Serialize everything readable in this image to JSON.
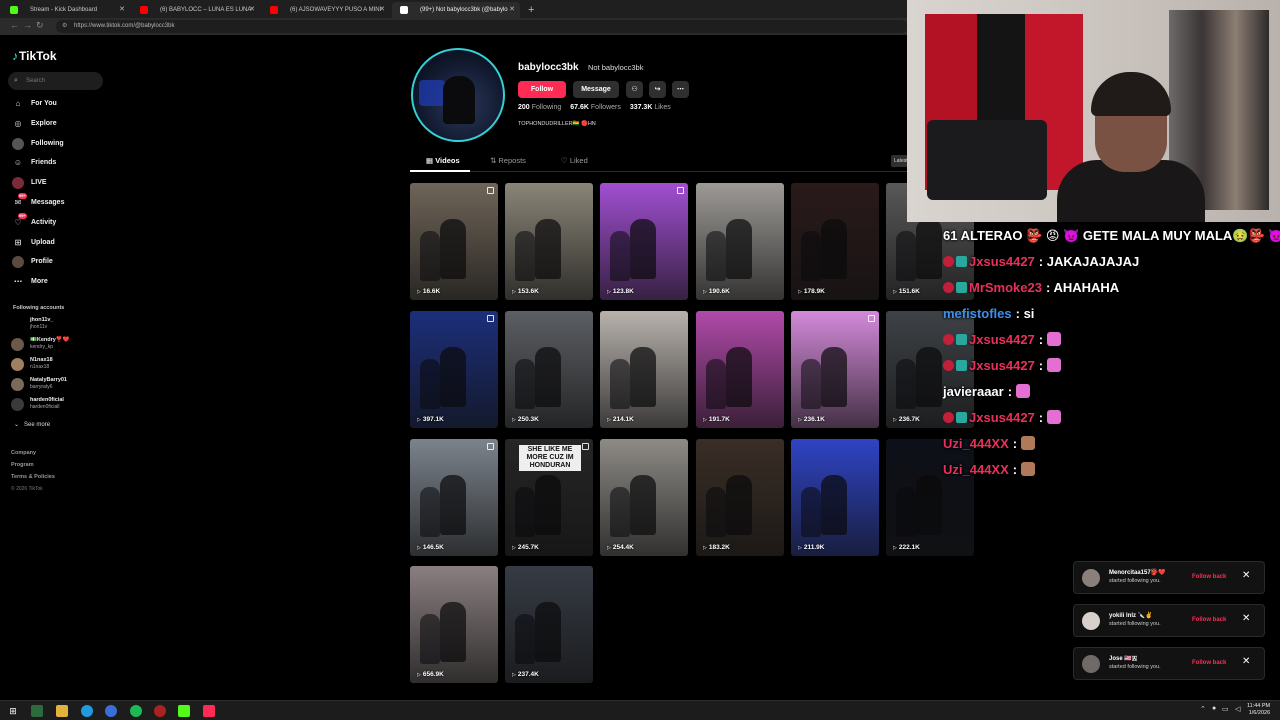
{
  "browser": {
    "tabs": [
      {
        "title": "Stream - Kick Dashboard",
        "fav_color": "#53fc18"
      },
      {
        "title": "(6) BABYLOCC – LUNA ES LUNA",
        "fav_color": "#ff0000"
      },
      {
        "title": "(6) AJSOWAVEYYY PUSO A MINI",
        "fav_color": "#ff0000"
      },
      {
        "title": "(99+) Not babylocc3bk (@babylo",
        "fav_color": "#ffffff"
      }
    ],
    "url": "https://www.tiktok.com/@babylocc3bk"
  },
  "sidebar": {
    "logo": "TikTok",
    "search_placeholder": "Search",
    "menu": [
      {
        "label": "For You",
        "icon": "home-icon"
      },
      {
        "label": "Explore",
        "icon": "compass-icon"
      },
      {
        "label": "Following",
        "icon": "following-icon"
      },
      {
        "label": "Friends",
        "icon": "friends-icon"
      },
      {
        "label": "LIVE",
        "icon": "live-icon"
      },
      {
        "label": "Messages",
        "icon": "messages-icon",
        "badge": "99+"
      },
      {
        "label": "Activity",
        "icon": "activity-icon",
        "badge": "99+"
      },
      {
        "label": "Upload",
        "icon": "upload-icon"
      },
      {
        "label": "Profile",
        "icon": "profile-icon"
      },
      {
        "label": "More",
        "icon": "more-icon"
      }
    ],
    "following_title": "Following accounts",
    "following": [
      {
        "name": "jhon11v_",
        "handle": "jhon11v"
      },
      {
        "name": "💵Kendry❣️❤️",
        "handle": "kendry_kp"
      },
      {
        "name": "N1nax18",
        "handle": "n1nax18"
      },
      {
        "name": "NatalyBarry01",
        "handle": "barryraty6"
      },
      {
        "name": "harden0ficial",
        "handle": "harden0ficiall"
      }
    ],
    "see_more": "See more",
    "footer": [
      "Company",
      "Program",
      "Terms & Policies",
      "© 2026 TikTok"
    ]
  },
  "profile": {
    "username": "babylocc3bk",
    "nickname": "Not babylocc3bk",
    "follow_label": "Follow",
    "message_label": "Message",
    "following_count": "200",
    "following_label": "Following",
    "followers_count": "67.6K",
    "followers_label": "Followers",
    "likes_count": "337.3K",
    "likes_label": "Likes",
    "bio": "TOPHONDUDRILLER🇧🇴 🔴HN",
    "tabs": [
      "Videos",
      "Reposts",
      "Liked"
    ],
    "latest_label": "Latest"
  },
  "videos": [
    {
      "views": "16.6K",
      "bg": "#6f6558",
      "pinned": true
    },
    {
      "views": "153.6K",
      "bg": "#8a8578",
      "pinned": false
    },
    {
      "views": "123.8K",
      "bg": "#a14fd1",
      "pinned": true
    },
    {
      "views": "190.6K",
      "bg": "#9d9a96",
      "pinned": false
    },
    {
      "views": "178.9K",
      "bg": "#2a1a1a",
      "pinned": false
    },
    {
      "views": "151.6K",
      "bg": "#585858",
      "pinned": false
    },
    {
      "views": "397.1K",
      "bg": "#1c2f7a",
      "pinned": true
    },
    {
      "views": "250.3K",
      "bg": "#5c5f63",
      "pinned": false
    },
    {
      "views": "214.1K",
      "bg": "#b8b2ad",
      "pinned": false
    },
    {
      "views": "191.7K",
      "bg": "#b04aa8",
      "pinned": false
    },
    {
      "views": "236.1K",
      "bg": "#d38ad9",
      "pinned": true
    },
    {
      "views": "236.7K",
      "bg": "#3e4246",
      "pinned": false
    },
    {
      "views": "146.5K",
      "bg": "#7c838c",
      "pinned": true
    },
    {
      "views": "245.7K",
      "bg": "#262626",
      "pinned": true
    },
    {
      "views": "254.4K",
      "bg": "#8e8b86",
      "pinned": false
    },
    {
      "views": "183.2K",
      "bg": "#3a2e26",
      "pinned": false
    },
    {
      "views": "211.9K",
      "bg": "#2f44c4",
      "pinned": false
    },
    {
      "views": "222.1K",
      "bg": "#0d1018",
      "pinned": false
    },
    {
      "views": "656.9K",
      "bg": "#8a7f80",
      "pinned": false
    },
    {
      "views": "237.4K",
      "bg": "#363b44",
      "pinned": false
    }
  ],
  "video_text": {
    "thumb14": "SHE LIKE ME MORE CUZ IM HONDURAN"
  },
  "chat": [
    {
      "user": "",
      "msg": "61 ALTERAO 👺 😡 👿 GETE MALA MUY MALA🤢👺 👿",
      "color": "#ffffff",
      "badge": false,
      "emote": false
    },
    {
      "user": "Jxsus4427",
      "msg": ": JAKAJAJAJAJ",
      "color": "#e8305a",
      "badge": true,
      "emote": false
    },
    {
      "user": "MrSmoke23",
      "msg": ": AHAHAHA",
      "color": "#e8305a",
      "badge": true,
      "emote": false
    },
    {
      "user": "mefistofles",
      "msg": ": si",
      "color": "#3f8fe8",
      "badge": false,
      "emote": false
    },
    {
      "user": "Jxsus4427",
      "msg": ":",
      "color": "#e8305a",
      "badge": true,
      "emote": true
    },
    {
      "user": "Jxsus4427",
      "msg": ":",
      "color": "#e8305a",
      "badge": true,
      "emote": true
    },
    {
      "user": "javieraaar",
      "msg": ":",
      "color": "#ffffff",
      "badge": false,
      "emote": true
    },
    {
      "user": "Jxsus4427",
      "msg": ":",
      "color": "#e8305a",
      "badge": true,
      "emote": true
    },
    {
      "user": "Uzi_444XX",
      "msg": ":",
      "color": "#e8305a",
      "badge": false,
      "emote": true
    },
    {
      "user": "Uzi_444XX",
      "msg": ":",
      "color": "#e8305a",
      "badge": false,
      "emote": true
    }
  ],
  "notifications": [
    {
      "name": "Menorcitaa157👺❤️",
      "sub": "started following you.",
      "action": "Follow back"
    },
    {
      "name": "yokili lnlz 🔪✌️",
      "sub": "started following you.",
      "action": "Follow back"
    },
    {
      "name": "Jose 🇺🇸🇦",
      "sub": "started following you.",
      "action": "Follow back"
    }
  ],
  "taskbar": {
    "time": "11:44 PM",
    "date": "1/6/2026"
  },
  "colors": {
    "accent": "#fe2c55",
    "teal": "#25f4ee"
  }
}
